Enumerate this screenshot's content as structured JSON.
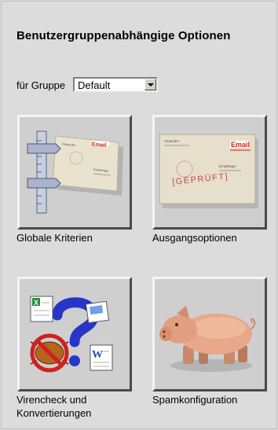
{
  "page": {
    "title": "Benutzergruppenabhängige Optionen"
  },
  "group": {
    "label": "für Gruppe",
    "selected": "Default"
  },
  "tiles": [
    {
      "caption": "Globale Kriterien",
      "icon": "ruler-envelope-icon",
      "envelope": {
        "line1": "Absender",
        "line2": "Empfänger",
        "email": "Email"
      }
    },
    {
      "caption": "Ausgangsoptionen",
      "icon": "checked-envelope-icon",
      "envelope": {
        "line1": "Absender",
        "line2": "Empfänger",
        "email": "Email",
        "stamp": "[GEPRÜFT]"
      }
    },
    {
      "caption_line1": "Virencheck und",
      "caption_line2": "Konvertierungen",
      "icon": "virus-conversion-icon",
      "doc_x": "X",
      "doc_w": "W"
    },
    {
      "caption": "Spamkonfiguration",
      "icon": "pig-icon"
    }
  ]
}
